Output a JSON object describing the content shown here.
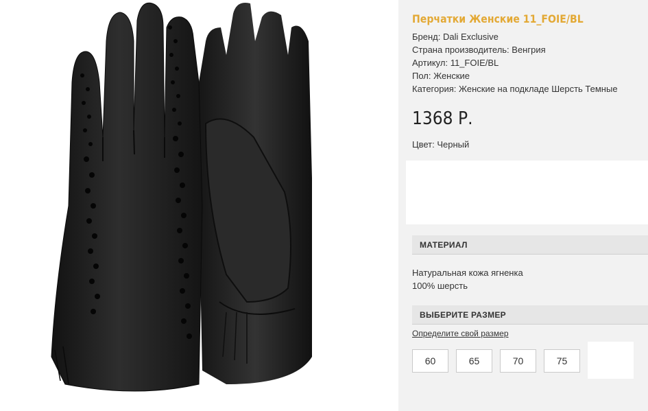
{
  "product": {
    "title": "Перчатки Женские 11_FOIE/BL",
    "brand": "Бренд: Dali Exclusive",
    "country": "Страна производитель: Венгрия",
    "article": "Артикул: 11_FOIE/BL",
    "gender": "Пол: Женские",
    "category": "Категория: Женские на подкладе Шерсть Темные",
    "price": "1368 Р.",
    "color": "Цвет: Черный"
  },
  "material": {
    "header": "МАТЕРИАЛ",
    "line1": "Натуральная кожа ягненка",
    "line2": "100% шерсть"
  },
  "sizes": {
    "header": "ВЫБЕРИТЕ РАЗМЕР",
    "link": "Определите свой размер",
    "options": [
      "60",
      "65",
      "70",
      "75"
    ]
  },
  "colors": {
    "title": "#e3a935",
    "panel": "#f2f2f2",
    "glove": "#1c1c1c"
  },
  "image": {
    "icon": "black-leather-gloves-photo"
  }
}
